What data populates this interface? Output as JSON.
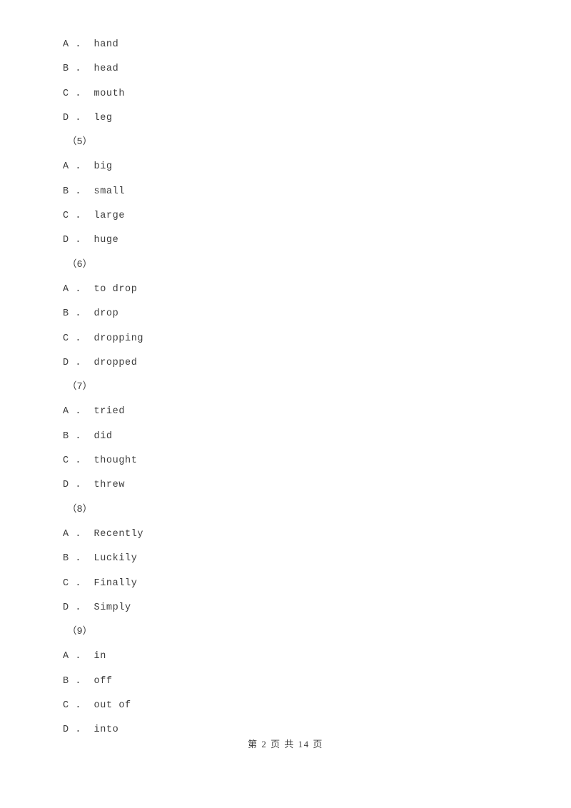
{
  "document": {
    "background_color": "#ffffff",
    "text_color": "#3c3c3c",
    "footer": "第 2 页 共 14 页",
    "page_number": "2",
    "total_pages": "14"
  },
  "lines": [
    {
      "kind": "option",
      "letter": "A",
      "sep": " .  ",
      "text": "hand"
    },
    {
      "kind": "option",
      "letter": "B",
      "sep": " .  ",
      "text": "head"
    },
    {
      "kind": "option",
      "letter": "C",
      "sep": " .  ",
      "text": "mouth"
    },
    {
      "kind": "option",
      "letter": "D",
      "sep": " .  ",
      "text": "leg"
    },
    {
      "kind": "qnum",
      "text": "（5）"
    },
    {
      "kind": "option",
      "letter": "A",
      "sep": " .  ",
      "text": "big"
    },
    {
      "kind": "option",
      "letter": "B",
      "sep": " .  ",
      "text": "small"
    },
    {
      "kind": "option",
      "letter": "C",
      "sep": " .  ",
      "text": "large"
    },
    {
      "kind": "option",
      "letter": "D",
      "sep": " .  ",
      "text": "huge"
    },
    {
      "kind": "qnum",
      "text": "（6）"
    },
    {
      "kind": "option",
      "letter": "A",
      "sep": " .  ",
      "text": "to drop"
    },
    {
      "kind": "option",
      "letter": "B",
      "sep": " .  ",
      "text": "drop"
    },
    {
      "kind": "option",
      "letter": "C",
      "sep": " .  ",
      "text": "dropping"
    },
    {
      "kind": "option",
      "letter": "D",
      "sep": " .  ",
      "text": "dropped"
    },
    {
      "kind": "qnum",
      "text": "（7）"
    },
    {
      "kind": "option",
      "letter": "A",
      "sep": " .  ",
      "text": "tried"
    },
    {
      "kind": "option",
      "letter": "B",
      "sep": " .  ",
      "text": "did"
    },
    {
      "kind": "option",
      "letter": "C",
      "sep": " .  ",
      "text": "thought"
    },
    {
      "kind": "option",
      "letter": "D",
      "sep": " .  ",
      "text": "threw"
    },
    {
      "kind": "qnum",
      "text": "（8）"
    },
    {
      "kind": "option",
      "letter": "A",
      "sep": " .  ",
      "text": "Recently"
    },
    {
      "kind": "option",
      "letter": "B",
      "sep": " .  ",
      "text": "Luckily"
    },
    {
      "kind": "option",
      "letter": "C",
      "sep": " .  ",
      "text": "Finally"
    },
    {
      "kind": "option",
      "letter": "D",
      "sep": " .  ",
      "text": "Simply"
    },
    {
      "kind": "qnum",
      "text": "（9）"
    },
    {
      "kind": "option",
      "letter": "A",
      "sep": " .  ",
      "text": "in"
    },
    {
      "kind": "option",
      "letter": "B",
      "sep": " .  ",
      "text": "off"
    },
    {
      "kind": "option",
      "letter": "C",
      "sep": " .  ",
      "text": "out of"
    },
    {
      "kind": "option",
      "letter": "D",
      "sep": " .  ",
      "text": "into"
    }
  ]
}
